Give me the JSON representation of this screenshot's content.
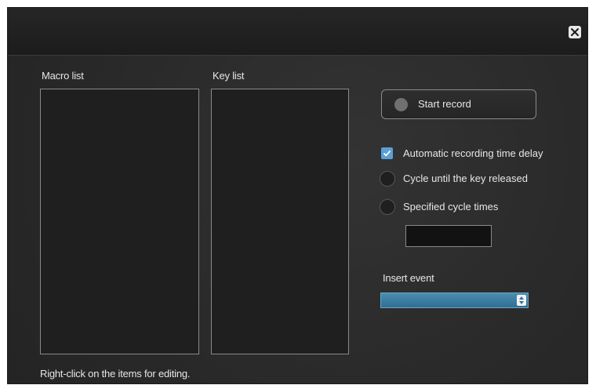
{
  "labels": {
    "macro_list": "Macro list",
    "key_list": "Key list",
    "insert_event": "Insert event",
    "hint": "Right-click on the items for editing."
  },
  "record": {
    "label": "Start record"
  },
  "options": {
    "auto_delay": {
      "label": "Automatic recording time delay",
      "checked": true
    },
    "cycle_released": {
      "label": "Cycle until the key released",
      "selected": false
    },
    "cycle_times": {
      "label": "Specified cycle times",
      "selected": false
    }
  },
  "cycle_times_input": {
    "value": ""
  },
  "insert_event_select": {
    "value": ""
  },
  "colors": {
    "accent": "#5aa0d8",
    "select": "#3a7ea3",
    "window_bg": "#2b2b2b"
  },
  "icons": {
    "close": "close-icon",
    "record": "record-dot-icon",
    "check": "checkmark-icon",
    "select": "updown-arrows-icon"
  }
}
